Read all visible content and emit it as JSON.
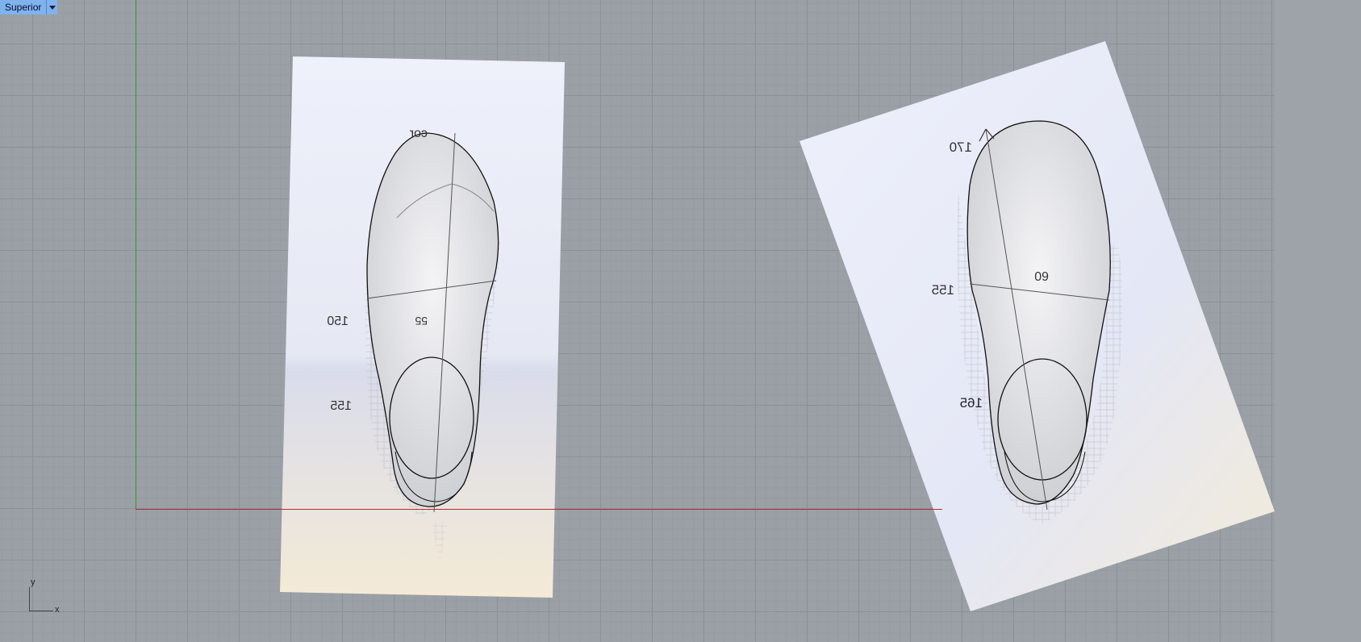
{
  "viewport": {
    "title": "Superior"
  },
  "axes_gizmo": {
    "y_label": "y",
    "x_label": "x"
  },
  "left_sheet": {
    "annotations": [
      "cor",
      "150",
      "55",
      "155"
    ]
  },
  "right_sheet": {
    "annotations": [
      "170",
      "155",
      "60",
      "165"
    ]
  },
  "colors": {
    "grid_bg": "#9aa0a6",
    "tab_bg": "#7fb3ee",
    "y_axis": "#2e9a2e",
    "x_axis": "#b03030"
  }
}
